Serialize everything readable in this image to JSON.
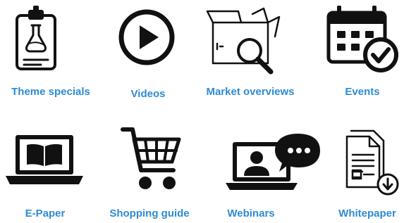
{
  "accent_color": "#2e8bd0",
  "icon_color": "#111111",
  "tiles": [
    {
      "label": "Theme specials",
      "icon": "clipboard-flask-icon"
    },
    {
      "label": "Videos",
      "icon": "play-icon"
    },
    {
      "label": "Market overviews",
      "icon": "box-magnifier-icon"
    },
    {
      "label": "Events",
      "icon": "calendar-check-icon"
    },
    {
      "label": "E-Paper",
      "icon": "laptop-book-icon"
    },
    {
      "label": "Shopping guide",
      "icon": "shopping-cart-icon"
    },
    {
      "label": "Webinars",
      "icon": "laptop-chat-icon"
    },
    {
      "label": "Whitepaper",
      "icon": "document-download-icon"
    }
  ]
}
